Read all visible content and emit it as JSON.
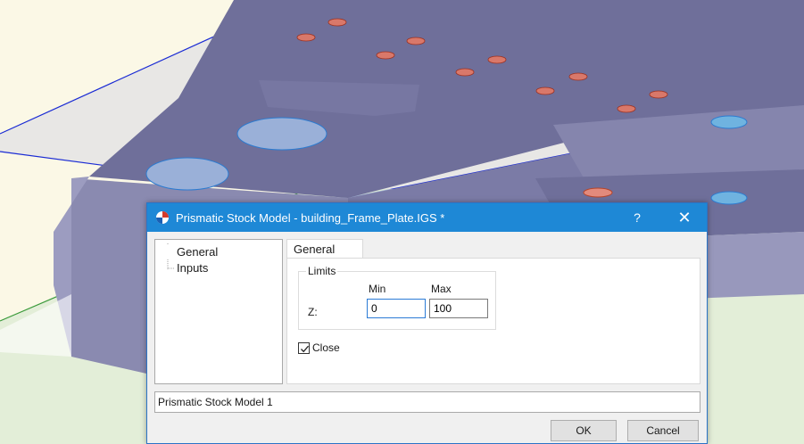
{
  "dialog": {
    "title": "Prismatic Stock Model - building_Frame_Plate.IGS *",
    "help_label": "?",
    "close_label": "✕",
    "tree": {
      "items": [
        {
          "label": "General"
        },
        {
          "label": "Inputs"
        }
      ]
    },
    "tab_label": "General",
    "limits": {
      "title": "Limits",
      "min_header": "Min",
      "max_header": "Max",
      "z_label": "Z:",
      "z_min": "0",
      "z_max": "100"
    },
    "close_checkbox": {
      "label": "Close",
      "checked": true
    },
    "name_value": "Prismatic Stock Model 1",
    "ok_label": "OK",
    "cancel_label": "Cancel"
  },
  "colors": {
    "titlebar": "#1e88d6",
    "plate": "#6f6f9a",
    "background": "#fbf8e6",
    "boundary_blue": "#1a2bd4",
    "boundary_green": "#3a9a3a"
  }
}
